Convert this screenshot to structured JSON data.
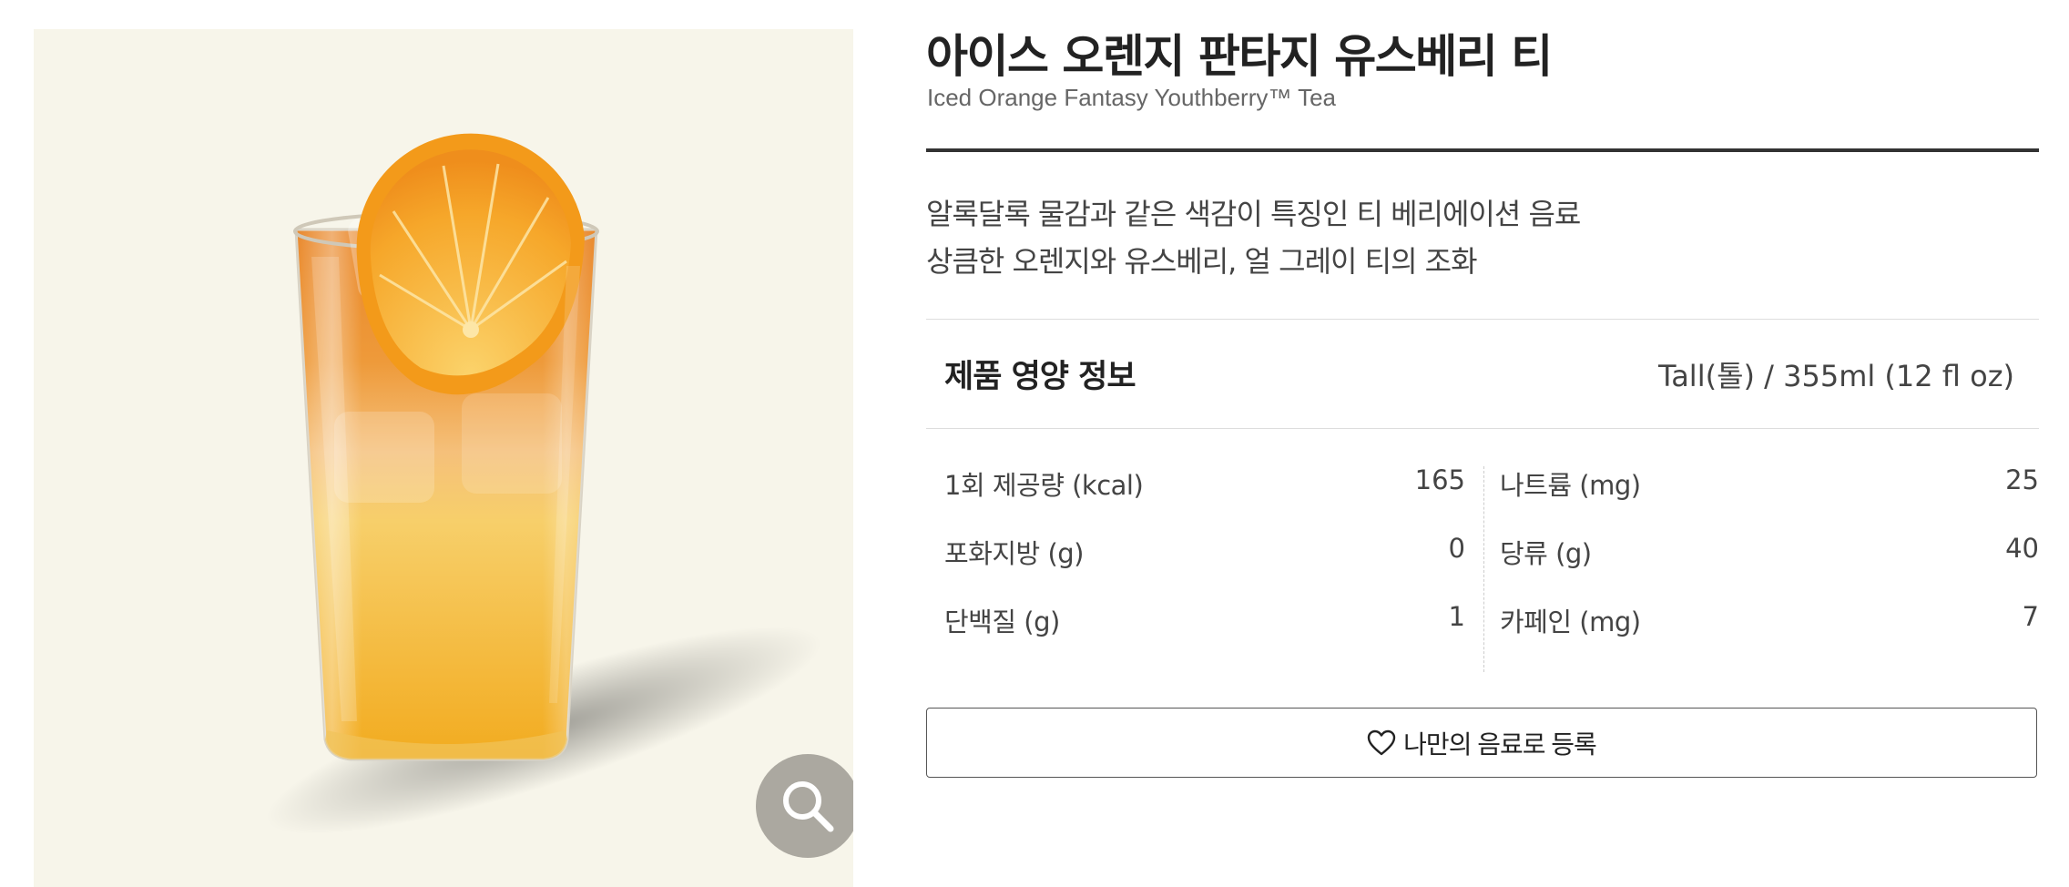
{
  "product": {
    "name_ko": "아이스 오렌지 판타지 유스베리 티",
    "name_en": "Iced Orange Fantasy Youthberry™ Tea",
    "description": [
      "알록달록 물감과 같은 색감이 특징인 티 베리에이션 음료",
      "상큼한 오렌지와 유스베리, 얼 그레이 티의 조화"
    ]
  },
  "image": {
    "zoom_icon": "search-icon",
    "background_color": "#f7f5ea"
  },
  "nutrition": {
    "title": "제품 영양 정보",
    "size": "Tall(톨) / 355ml (12 fl oz)",
    "left": [
      {
        "label": "1회 제공량 (kcal)",
        "value": "165"
      },
      {
        "label": "포화지방 (g)",
        "value": "0"
      },
      {
        "label": "단백질 (g)",
        "value": "1"
      }
    ],
    "right": [
      {
        "label": "나트륨 (mg)",
        "value": "25"
      },
      {
        "label": "당류 (g)",
        "value": "40"
      },
      {
        "label": "카페인 (mg)",
        "value": "7"
      }
    ]
  },
  "actions": {
    "favorite_label": "나만의 음료로 등록",
    "favorite_icon": "heart-outline-icon"
  }
}
